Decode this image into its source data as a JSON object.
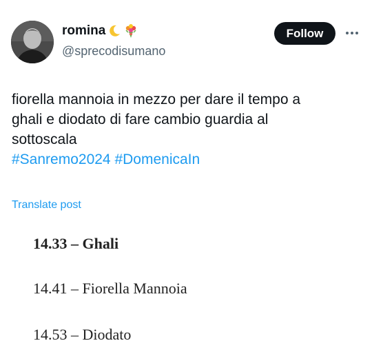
{
  "author": {
    "display_name": "romina",
    "name_emojis": [
      "crescent-moon-emoji",
      "bouquet-emoji"
    ],
    "handle": "@sprecodisumano"
  },
  "actions": {
    "follow_label": "Follow",
    "more_icon": "more-dots-icon"
  },
  "post": {
    "line1": "fiorella mannoia in mezzo per dare il tempo a",
    "line2": "ghali e diodato di fare cambio guardia al",
    "line3": "sottoscala",
    "hashtag1": "#Sanremo2024",
    "hashtag2": "#DomenicaIn"
  },
  "translate_label": "Translate post",
  "schedule": [
    "14.33 – Ghali",
    "14.41 – Fiorella Mannoia",
    "14.53 – Diodato"
  ],
  "colors": {
    "link": "#1d9bf0",
    "text": "#0f1419",
    "secondary": "#536471",
    "follow_bg": "#0f1419"
  }
}
